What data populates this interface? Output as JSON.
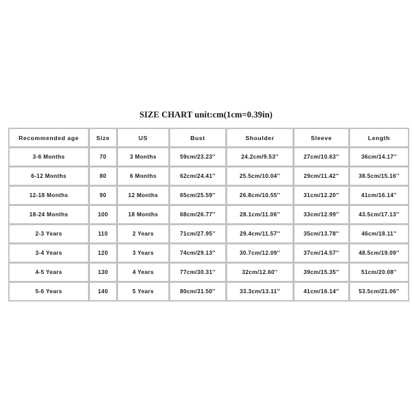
{
  "title": "SIZE CHART unit:cm(1cm=0.39in)",
  "table": {
    "columns": [
      "Recommended age",
      "Size",
      "US",
      "Bust",
      "Shoulder",
      "Sleeve",
      "Length"
    ],
    "rows": [
      [
        "3-6 Months",
        "70",
        "3 Months",
        "59cm/23.23''",
        "24.2cm/9.53''",
        "27cm/10.63''",
        "36cm/14.17''"
      ],
      [
        "6-12 Months",
        "80",
        "6 Months",
        "62cm/24.41''",
        "25.5cm/10.04''",
        "29cm/11.42''",
        "38.5cm/15.16''"
      ],
      [
        "12-18 Months",
        "90",
        "12 Months",
        "65cm/25.59''",
        "26.8cm/10.55''",
        "31cm/12.20''",
        "41cm/16.14''"
      ],
      [
        "18-24 Months",
        "100",
        "18 Months",
        "68cm/26.77''",
        "28.1cm/11.06''",
        "33cm/12.99''",
        "43.5cm/17.13''"
      ],
      [
        "2-3 Years",
        "110",
        "2 Years",
        "71cm/27.95''",
        "29.4cm/11.57''",
        "35cm/13.78''",
        "46cm/18.11''"
      ],
      [
        "3-4 Years",
        "120",
        "3 Years",
        "74cm/29.13''",
        "30.7cm/12.09''",
        "37cm/14.57''",
        "48.5cm/19.09''"
      ],
      [
        "4-5 Years",
        "130",
        "4 Years",
        "77cm/30.31''",
        "32cm/12.60''",
        "39cm/15.35''",
        "51cm/20.08''"
      ],
      [
        "5-6 Years",
        "140",
        "5 Years",
        "80cm/31.50''",
        "33.3cm/13.11''",
        "41cm/16.14''",
        "53.5cm/21.06''"
      ]
    ]
  },
  "colors": {
    "background": "#ffffff",
    "text": "#1a1a1a",
    "border": "#c9c9c9"
  }
}
